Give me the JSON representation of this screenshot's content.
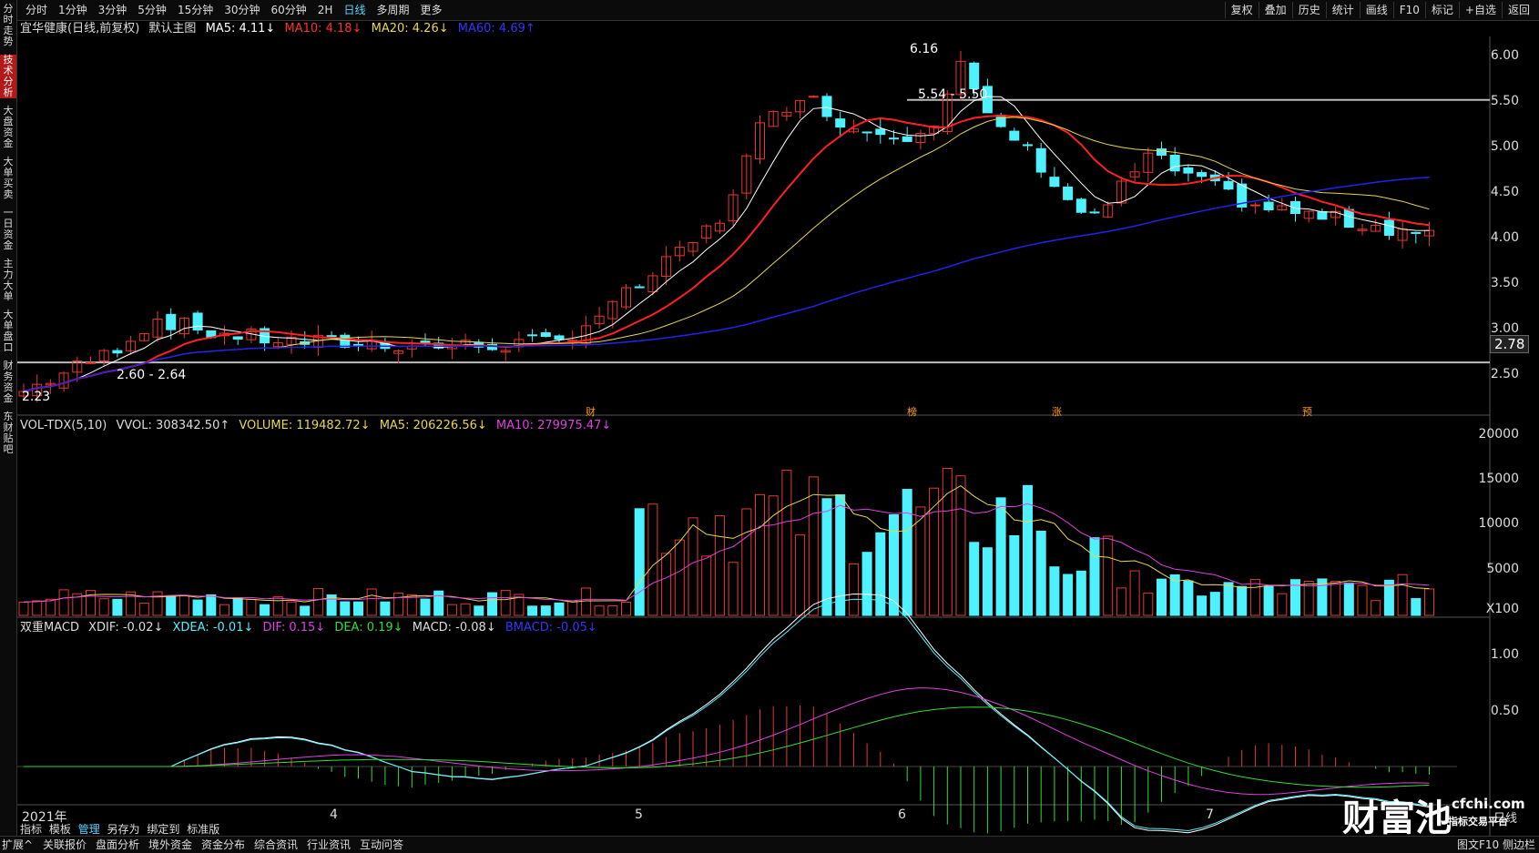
{
  "top_tabs": [
    "分时",
    "1分钟",
    "3分钟",
    "5分钟",
    "15分钟",
    "30分钟",
    "60分钟",
    "2H",
    "日线",
    "多周期",
    "更多"
  ],
  "active_tab": "日线",
  "tools": [
    "复权",
    "叠加",
    "历史",
    "统计",
    "画线",
    "F10",
    "标记",
    "+自选",
    "返回"
  ],
  "side_items": [
    "分时走势",
    "技术分析",
    "大盘资金",
    "大单买卖",
    "一日资金",
    "主力大单",
    "大单盘口",
    "财务资金",
    "东财贴吧"
  ],
  "active_side": "技术分析",
  "main_legend": {
    "title": "宜华健康(日线,前复权)",
    "template": "默认主图",
    "ma5": "MA5: 4.11↓",
    "ma10": "MA10: 4.18↓",
    "ma20": "MA20: 4.26↓",
    "ma60": "MA60: 4.69↑"
  },
  "vol_legend": {
    "name": "VOL-TDX(5,10)",
    "vvol": "VVOL: 308342.50↑",
    "volume": "VOLUME: 119482.72↓",
    "ma5": "MA5: 206226.56↓",
    "ma10": "MA10: 279975.47↓"
  },
  "macd_legend": {
    "name": "双重MACD",
    "xdif": "XDIF: -0.02↓",
    "xdea": "XDEA: -0.01↓",
    "dif": "DIF: 0.15↓",
    "dea": "DEA: 0.19↓",
    "macd": "MACD: -0.08↓",
    "bmacd": "BMACD: -0.05↓"
  },
  "price_axis": [
    "6.00",
    "5.50",
    "5.00",
    "4.50",
    "4.00",
    "3.50",
    "3.00",
    "2.50"
  ],
  "current_price_tag": "2.78",
  "vol_axis": [
    "20000",
    "15000",
    "10000",
    "5000",
    "X100"
  ],
  "macd_axis": [
    "1.00",
    "0.50"
  ],
  "x_axis": [
    "2021年",
    "4",
    "5",
    "6",
    "7"
  ],
  "annotations": {
    "high": "6.16",
    "low": "2.23",
    "support": "2.60 - 2.64",
    "resistance": "5.54 - 5.50"
  },
  "event_tags": [
    "财",
    "榜",
    "涨",
    "预"
  ],
  "bottom_items": [
    "扩展^",
    "关联报价",
    "盘面分析",
    "境外资金",
    "资金分布",
    "综合资讯",
    "行业资讯",
    "互动问答"
  ],
  "bottom_left_small": [
    "指标",
    "模板",
    "管理",
    "另存为",
    "绑定到",
    "标准版"
  ],
  "period_label": "日线",
  "status_right": "图文F10 侧边栏",
  "watermark": {
    "brand": "财富池",
    "url": "cfchi.com",
    "sub": "指标交易平台"
  },
  "colors": {
    "up": "#e8382f",
    "down": "#4ef2ff",
    "ma5": "#ffffff",
    "ma10": "#ff2020",
    "ma20": "#e6d84a",
    "ma60": "#2222ee"
  }
}
